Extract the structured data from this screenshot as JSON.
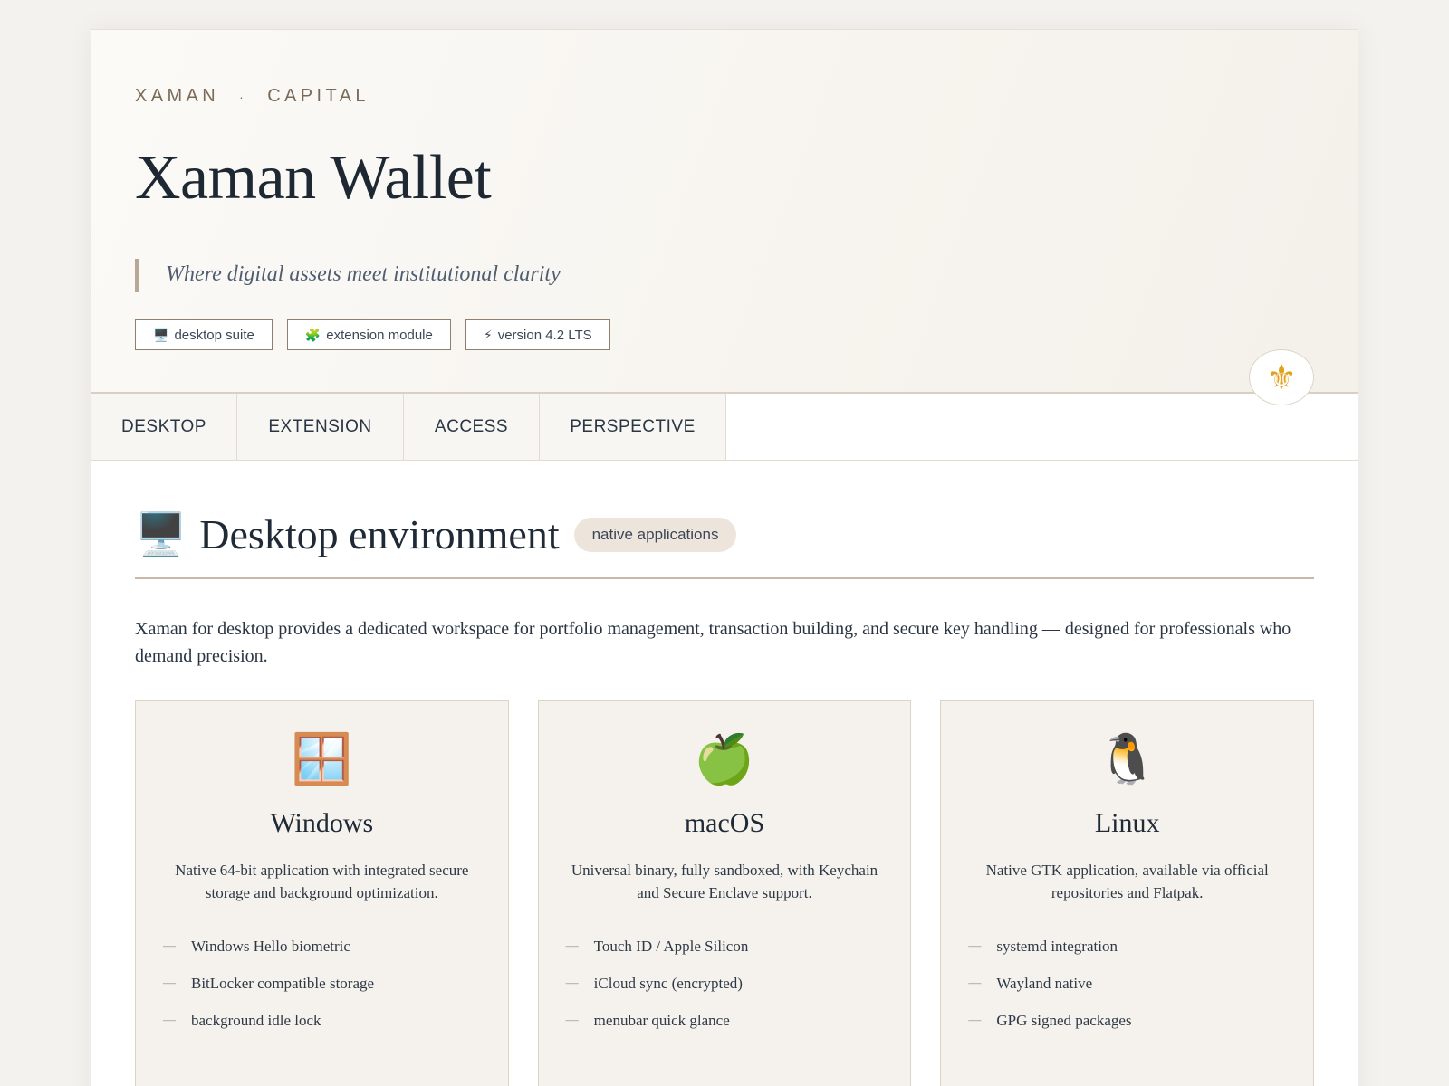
{
  "header": {
    "brand_left": "XAMAN",
    "brand_sep": "·",
    "brand_right": "CAPITAL",
    "title": "Xaman Wallet",
    "tagline": "Where digital assets meet institutional clarity",
    "badges": [
      {
        "icon": "🖥️",
        "label": "desktop suite"
      },
      {
        "icon": "🧩",
        "label": "extension module"
      },
      {
        "icon": "⚡",
        "label": "version 4.2 LTS"
      }
    ],
    "seal_icon": "⚜"
  },
  "tabs": [
    {
      "label": "DESKTOP"
    },
    {
      "label": "EXTENSION"
    },
    {
      "label": "ACCESS"
    },
    {
      "label": "PERSPECTIVE"
    }
  ],
  "section": {
    "icon": "🖥️",
    "title": "Desktop environment",
    "pill": "native applications",
    "intro": "Xaman for desktop provides a dedicated workspace for portfolio management, transaction building, and secure key handling — designed for professionals who demand precision."
  },
  "cards": [
    {
      "icon": "🪟",
      "title": "Windows",
      "desc": "Native 64-bit application with integrated secure storage and background optimization.",
      "features": [
        "Windows Hello biometric",
        "BitLocker compatible storage",
        "background idle lock"
      ]
    },
    {
      "icon": "🍏",
      "title": "macOS",
      "desc": "Universal binary, fully sandboxed, with Keychain and Secure Enclave support.",
      "features": [
        "Touch ID / Apple Silicon",
        "iCloud sync (encrypted)",
        "menubar quick glance"
      ]
    },
    {
      "icon": "🐧",
      "title": "Linux",
      "desc": "Native GTK application, available via official repositories and Flatpak.",
      "features": [
        "systemd integration",
        "Wayland native",
        "GPG signed packages"
      ]
    }
  ],
  "list_dash": "—"
}
